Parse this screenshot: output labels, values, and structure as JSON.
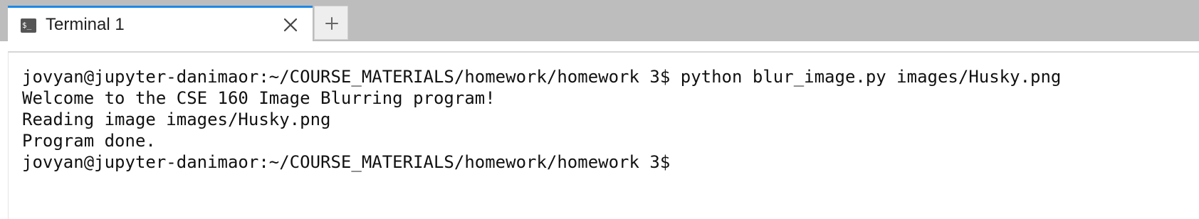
{
  "tab": {
    "icon": "terminal-icon",
    "icon_glyph": "$_",
    "title": "Terminal 1",
    "close_icon": "close-icon"
  },
  "add_tab": {
    "icon": "plus-icon"
  },
  "terminal": {
    "lines": [
      "jovyan@jupyter-danimaor:~/COURSE_MATERIALS/homework/homework 3$ python blur_image.py images/Husky.png",
      "Welcome to the CSE 160 Image Blurring program!",
      "Reading image images/Husky.png",
      "Program done.",
      "jovyan@jupyter-danimaor:~/COURSE_MATERIALS/homework/homework 3$"
    ]
  },
  "colors": {
    "tabbar_background": "#bdbdbd",
    "active_tab_accent": "#1e88e5",
    "terminal_background": "#ffffff",
    "terminal_text": "#111111"
  }
}
